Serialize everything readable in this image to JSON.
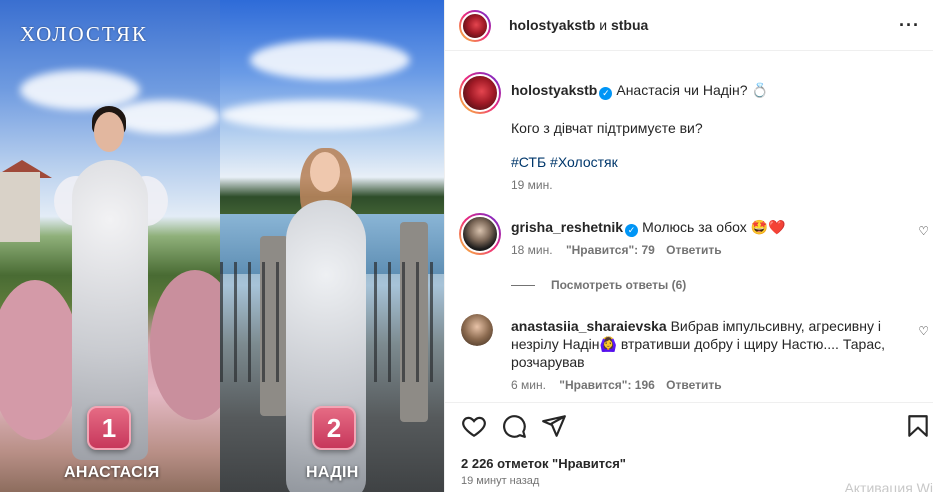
{
  "media": {
    "logo": "ХОЛОСТЯК",
    "left": {
      "number": "1",
      "name": "АНАСТАСІЯ"
    },
    "right": {
      "number": "2",
      "name": "НАДІН"
    }
  },
  "header": {
    "username": "holostyakstb",
    "connector": " и ",
    "collaborator": "stbua",
    "more_icon": "more-horizontal-icon"
  },
  "caption": {
    "username": "holostyakstb",
    "text": "Анастасія чи Надін? 💍",
    "question": "Кого з дівчат підтримуєте ви?",
    "hashtags": "#СТБ #Холостяк",
    "time": "19 мин."
  },
  "comments": [
    {
      "username": "grisha_reshetnik",
      "text": "Молюсь за обох 🤩❤️",
      "time": "18 мин.",
      "likes": "\"Нравится\": 79",
      "reply": "Ответить",
      "view_replies": "Посмотреть ответы (6)"
    },
    {
      "username": "anastasiia_sharaievska",
      "text": "Вибрав імпульсивну, агресивну і незрілу Надін🙆‍♀️ втративши добру і щиру Настю.... Тарас, розчарував",
      "time": "6 мин.",
      "likes": "\"Нравится\": 196",
      "reply": "Ответить"
    }
  ],
  "actions": {
    "like_icon": "heart-icon",
    "comment_icon": "comment-icon",
    "share_icon": "send-icon",
    "save_icon": "bookmark-icon"
  },
  "likes_count": "2 226 отметок \"Нравится\"",
  "posted": "19 минут назад",
  "watermark": "Активация Wi"
}
